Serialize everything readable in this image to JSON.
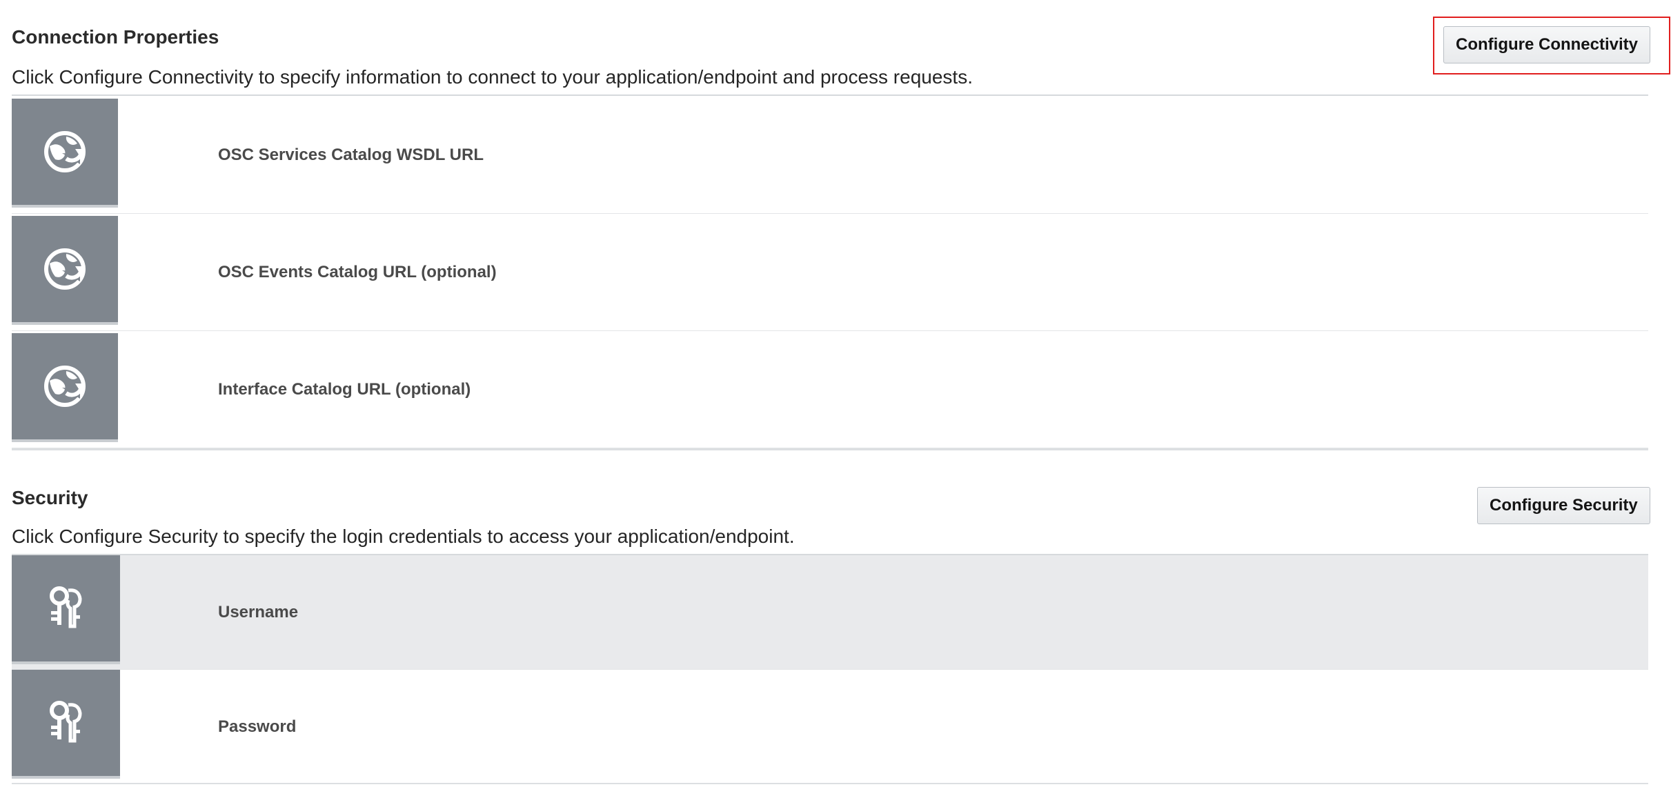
{
  "connection": {
    "title": "Connection Properties",
    "description": "Click Configure Connectivity to specify information to connect to your application/endpoint and process requests.",
    "button_label": "Configure Connectivity",
    "properties": [
      {
        "label": "OSC Services Catalog WSDL URL",
        "icon": "globe-refresh-icon"
      },
      {
        "label": "OSC Events Catalog URL (optional)",
        "icon": "globe-refresh-icon"
      },
      {
        "label": "Interface Catalog URL (optional)",
        "icon": "globe-refresh-icon"
      }
    ]
  },
  "security": {
    "title": "Security",
    "description": "Click Configure Security to specify the login credentials to access your application/endpoint.",
    "button_label": "Configure Security",
    "properties": [
      {
        "label": "Username",
        "icon": "keys-icon",
        "selected": true
      },
      {
        "label": "Password",
        "icon": "keys-icon",
        "selected": false
      }
    ]
  },
  "colors": {
    "highlight": "#e11d1d",
    "tile": "#7f868e",
    "selected_row": "#e9eaec"
  }
}
